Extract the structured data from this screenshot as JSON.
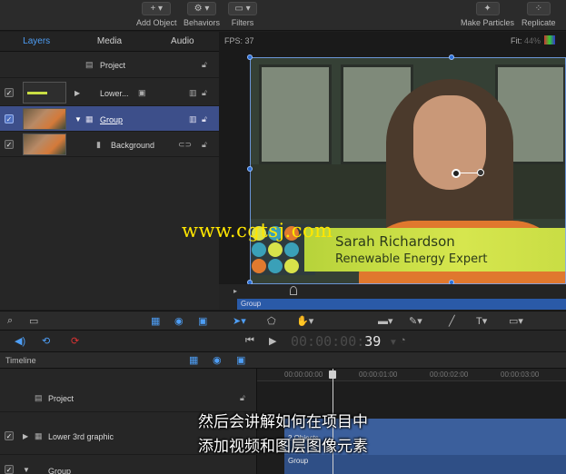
{
  "toolbar": {
    "add_object": "Add Object",
    "behaviors": "Behaviors",
    "filters": "Filters",
    "make_particles": "Make Particles",
    "replicate": "Replicate"
  },
  "tabs": [
    "Layers",
    "Media",
    "Audio"
  ],
  "layers": {
    "project": "Project",
    "lower": "Lower...",
    "group": "Group",
    "background": "Background"
  },
  "canvas": {
    "fps_label": "FPS: 37",
    "fit_label": "Fit:",
    "fit_value": "44%",
    "name": "Sarah Richardson",
    "title": "Renewable Energy Expert",
    "watermark": "www.cgtsj.com",
    "mini_group": "Group"
  },
  "transport": {
    "timecode_dim": "00:00:00:",
    "timecode_frame": "39"
  },
  "timeline": {
    "header": "Timeline",
    "ticks": [
      "00:00:00:00",
      "00:00:01:00",
      "00:00:02:00",
      "00:00:03:00"
    ],
    "project": "Project",
    "lower_track": "Lower 3rd graphic",
    "lower_clip": "2 Objects",
    "group_track": "Group",
    "group_clip": "Group"
  },
  "subtitle": {
    "line1": "然后会讲解如何在项目中",
    "line2": "添加视频和图层图像元素"
  },
  "colors": {
    "accent": "#4e9ef5",
    "selection": "#3d4f8a",
    "lower_third": "#c9dd44",
    "shirt": "#e0782e"
  }
}
